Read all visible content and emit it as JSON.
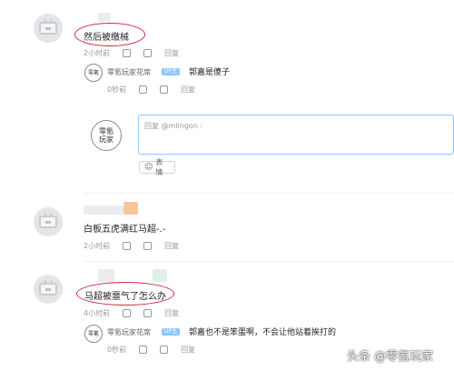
{
  "comments": [
    {
      "text": "然后被缴械",
      "time": "2小时前",
      "reply_label": "回复",
      "replies": [
        {
          "user": "零氪玩家花席",
          "badge": "UP主",
          "text": "郭嘉是傻子",
          "time": "0秒前",
          "reply_label": "回复"
        }
      ]
    },
    {
      "text": "白板五虎满红马超-.-",
      "time": "2小时前",
      "reply_label": "回复"
    },
    {
      "text": "马超被噩气了怎么办",
      "time": "4小时前",
      "reply_label": "回复",
      "replies": [
        {
          "user": "零氪玩家花席",
          "badge": "UP主",
          "text": "郭嘉也不是笨蛋啊，不会让他站着挨打的",
          "time": "0秒前",
          "reply_label": "回复"
        }
      ]
    }
  ],
  "reply_box": {
    "avatar_text_1": "零氪",
    "avatar_text_2": "玩家",
    "placeholder": "回复 @mlingon :",
    "emoji_label": "表情"
  },
  "watermark": "头条 @零氪玩家"
}
